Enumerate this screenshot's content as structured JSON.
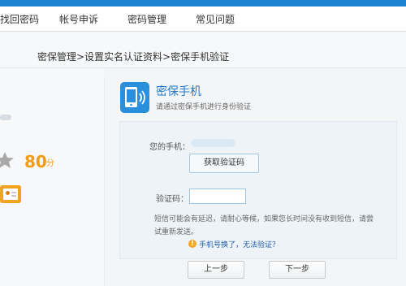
{
  "nav": {
    "items": [
      "找回密码",
      "帐号申诉",
      "密码管理",
      "常见问题"
    ]
  },
  "breadcrumb": "密保管理>设置实名认证资料>密保手机验证",
  "profile": {
    "score": "80",
    "score_unit": "分"
  },
  "panel": {
    "title": "密保手机",
    "subtitle": "请通过密保手机进行身份验证"
  },
  "form": {
    "phone_label": "您的手机：",
    "get_code_label": "获取验证码",
    "code_label": "验证码：",
    "code_value": "",
    "hint": "短信可能会有延迟，请耐心等候，如果您长时间没有收到短信，请尝试重新发送。",
    "warn_icon": "!",
    "warn_link": "手机号换了，无法验证？"
  },
  "buttons": {
    "prev": "上一步",
    "next": "下一步"
  },
  "colors": {
    "accent": "#1b82d1",
    "score": "#f39c12",
    "link": "#1f5fa8"
  },
  "icons": {
    "phone": "phone-icon",
    "star": "star-icon",
    "id_card": "id-card-icon",
    "warning": "warning-icon"
  }
}
